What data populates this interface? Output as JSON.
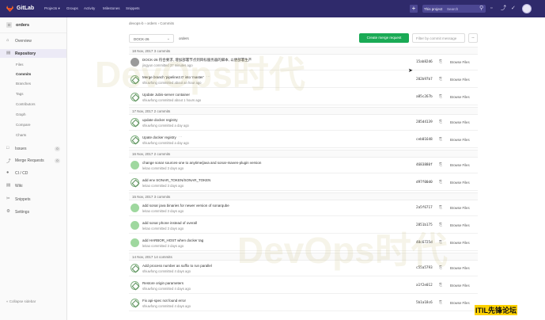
{
  "topbar": {
    "brand": "GitLab",
    "nav": [
      "Projects ▾",
      "Groups",
      "Activity",
      "Milestones",
      "Snippets"
    ],
    "scope_label": "This project",
    "search_placeholder": "Search"
  },
  "sidebar": {
    "project_initial": "O",
    "project_name": "orders",
    "items": [
      {
        "label": "Overview",
        "icon": "home-icon"
      },
      {
        "label": "Repository",
        "icon": "book-icon"
      },
      {
        "label": "Issues",
        "icon": "issues-icon",
        "count": "0"
      },
      {
        "label": "Merge Requests",
        "icon": "merge-request-icon",
        "count": "0"
      },
      {
        "label": "CI / CD",
        "icon": "rocket-icon"
      },
      {
        "label": "Wiki",
        "icon": "book-icon"
      },
      {
        "label": "Snippets",
        "icon": "snippet-icon"
      },
      {
        "label": "Settings",
        "icon": "gear-icon"
      }
    ],
    "repo_subitems": [
      "Files",
      "Commits",
      "Branches",
      "Tags",
      "Contributors",
      "Graph",
      "Compare",
      "Charts"
    ],
    "collapse_label": "« Collapse sidebar"
  },
  "main": {
    "breadcrumb": "devops-b  ›  orders  ›  Commits",
    "branch": "DOCK-26",
    "path": "orders",
    "create_mr_label": "Create merge request",
    "filter_placeholder": "Filter by commit message",
    "browse_label": "Browse Files",
    "days": [
      {
        "header": "18 Nov, 2017 3 commits",
        "commits": [
          {
            "title": "DOCK-26 符合要求, 增加部署节点到目标服务器的脚本, 以便部署生产",
            "meta": "jingyun committed 37 minutes ago",
            "sha": "15ab82d6",
            "avatar": "photo"
          },
          {
            "title": "Merge branch 'pipeline2.0' into 'master'",
            "meta": "shiuwfong committed about an hour ago",
            "sha": "202b97b7",
            "avatar": "pattern",
            "ellipsis": "···"
          },
          {
            "title": "Update Jubis-server container",
            "meta": "shiuwfong committed about 1 hours ago",
            "sha": "a85c267b",
            "avatar": "pattern"
          }
        ]
      },
      {
        "header": "17 Nov, 2017 2 commits",
        "commits": [
          {
            "title": "update docker registry",
            "meta": "shiuwfong committed a day ago",
            "sha": "285d4139",
            "avatar": "pattern"
          },
          {
            "title": "Upate docker registry",
            "meta": "shiuwfong committed a day ago",
            "sha": "ceb01648",
            "avatar": "pattern",
            "ellipsis": "···"
          }
        ]
      },
      {
        "header": "16 Nov, 2017 2 commits",
        "commits": [
          {
            "title": "change sonar sources-one to anytime/java and sonar-maven-plugin version",
            "meta": "leitao committed 3 days ago",
            "sha": "4683880f",
            "avatar": "green"
          },
          {
            "title": "add env SONAR_TOKEN/SONAR_TOKEN",
            "meta": "leitao committed 3 days ago",
            "sha": "d97f00d0",
            "avatar": "pattern"
          }
        ]
      },
      {
        "header": "15 Nov, 2017 3 commits",
        "commits": [
          {
            "title": "add sonar java binaries for newer version of sonarqube",
            "meta": "leitao committed 3 days ago",
            "sha": "2a5f6717",
            "avatar": "green"
          },
          {
            "title": "add sonar phone instead of overall",
            "meta": "leitao committed 3 days ago",
            "sha": "2851b175",
            "avatar": "green"
          },
          {
            "title": "add HARBOR_HOST when docker tag",
            "meta": "leitao committed 3 days ago",
            "sha": "48c6725d",
            "avatar": "green"
          }
        ]
      },
      {
        "header": "14 Nov, 2017 14 commits",
        "commits": [
          {
            "title": "Add process number as suffix to run parallel",
            "meta": "shiuwfong committed 4 days ago",
            "sha": "c55a5793",
            "avatar": "pattern"
          },
          {
            "title": "Restore origin parameters",
            "meta": "shiuwfong committed 4 days ago",
            "sha": "a1f2e012",
            "avatar": "pattern"
          },
          {
            "title": "Fix api-spec not found error",
            "meta": "shiuwfong committed 4 days ago",
            "sha": "5b1a18c6",
            "avatar": "pattern"
          }
        ]
      }
    ]
  },
  "watermark": {
    "text": "DevOps时代",
    "badge": "ITIL先锋论坛"
  }
}
